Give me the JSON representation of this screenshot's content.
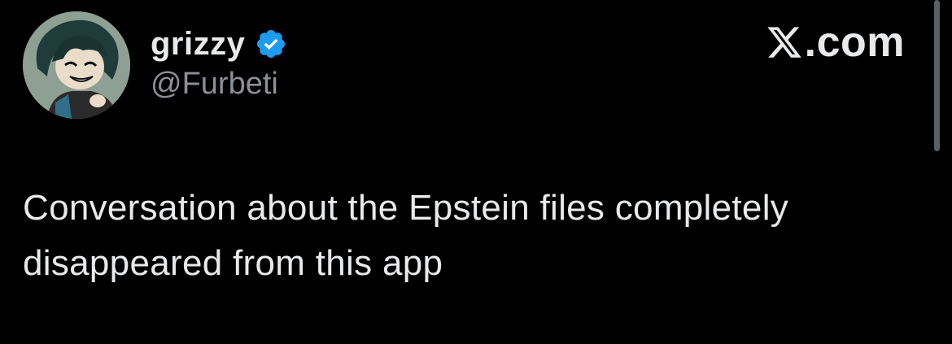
{
  "author": {
    "display_name": "grizzy",
    "handle": "@Furbeti",
    "avatar_icon": "cartoon-girl-avatar",
    "verified_icon": "verified-badge-icon"
  },
  "brand": {
    "text": ".com",
    "icon": "x-logo-icon"
  },
  "tweet": {
    "text": "Conversation about the Epstein files completely disappeared from this app"
  },
  "colors": {
    "background": "#000000",
    "primary_text": "#e7e9ea",
    "secondary_text": "#8b9096",
    "verified_blue": "#1d9bf0"
  }
}
